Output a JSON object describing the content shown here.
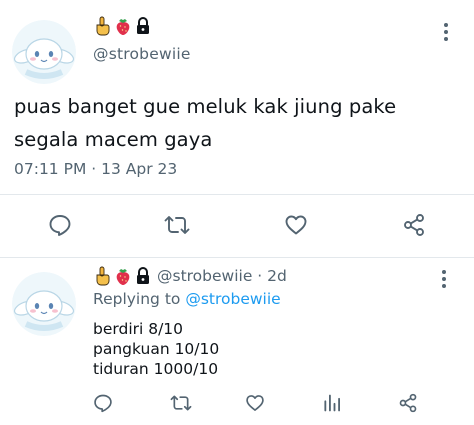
{
  "accent_color": "#1d9bf0",
  "muted_color": "#536471",
  "main_tweet": {
    "avatar_icon": "cinnamoroll-avatar",
    "badges": [
      "pointing-up-emoji",
      "strawberry-emoji",
      "lock-icon"
    ],
    "handle": "@strobewiie",
    "text": "puas banget gue meluk kak jiung pake segala macem gaya",
    "timestamp": "07:11 PM · 13 Apr 23",
    "actions": [
      "reply-icon",
      "retweet-icon",
      "like-icon",
      "share-icon"
    ]
  },
  "reply_tweet": {
    "avatar_icon": "cinnamoroll-avatar",
    "badges": [
      "pointing-up-emoji",
      "strawberry-emoji",
      "lock-icon"
    ],
    "handle": "@strobewiie",
    "age": " · 2d",
    "replying_label": "Replying to",
    "replying_to": "@strobewiie",
    "lines": [
      "berdiri 8/10",
      "pangkuan 10/10",
      "tiduran 1000/10"
    ],
    "actions": [
      "reply-icon",
      "retweet-icon",
      "like-icon",
      "analytics-icon",
      "share-icon"
    ]
  }
}
